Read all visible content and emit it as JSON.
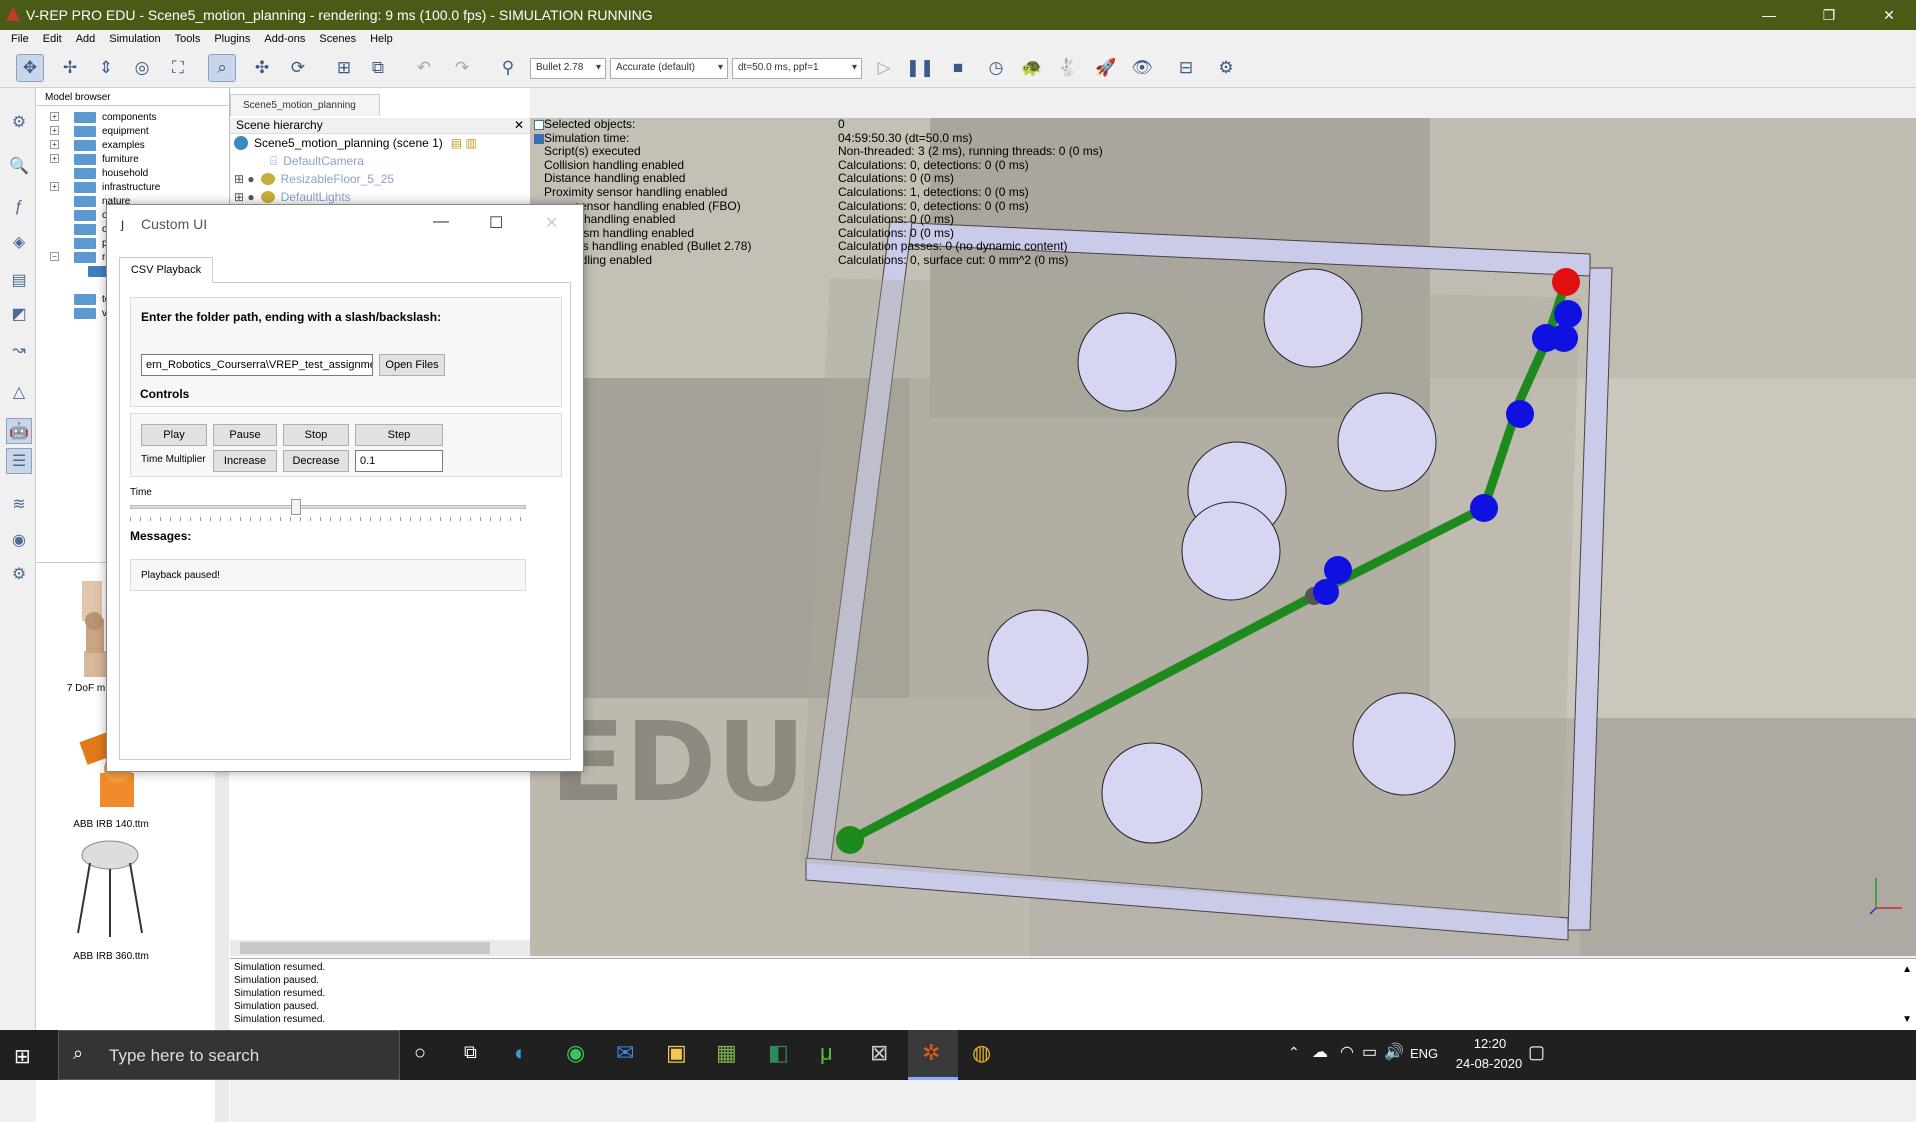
{
  "title": "V-REP PRO EDU - Scene5_motion_planning - rendering: 9 ms (100.0 fps) - SIMULATION RUNNING",
  "menu": [
    "File",
    "Edit",
    "Add",
    "Simulation",
    "Tools",
    "Plugins",
    "Add-ons",
    "Scenes",
    "Help"
  ],
  "toolbar": {
    "engine": "Bullet 2.78",
    "accuracy": "Accurate (default)",
    "timestep": "dt=50.0 ms, ppf=1"
  },
  "model_browser": {
    "header": "Model browser",
    "items": [
      "components",
      "equipment",
      "examples",
      "furniture",
      "household",
      "infrastructure",
      "nature",
      "of",
      "ot",
      "pe",
      "ro",
      "to",
      "ve"
    ],
    "thumbs": [
      "7 DoF m",
      "ABB IRB 140.ttm",
      "ABB IRB 360.ttm"
    ]
  },
  "scene_tab": "Scene5_motion_planning",
  "hierarchy": {
    "header": "Scene hierarchy",
    "rows": [
      "Scene5_motion_planning (scene 1)",
      "DefaultCamera",
      "ResizableFloor_5_25",
      "DefaultLights"
    ]
  },
  "info": {
    "keys": [
      "Selected objects:",
      "Simulation time:",
      "Script(s) executed",
      "Collision handling enabled",
      "Distance handling enabled",
      "Proximity sensor handling enabled",
      "sensor handling enabled (FBO)",
      "p handling enabled",
      "nism handling enabled",
      "ics handling enabled (Bullet 2.78)",
      "ndling enabled"
    ],
    "values": [
      "0",
      "04:59:50.30 (dt=50.0 ms)",
      "Non-threaded: 3 (2 ms), running threads: 0 (0 ms)",
      "Calculations: 0, detections: 0 (0 ms)",
      "Calculations: 0 (0 ms)",
      "Calculations: 1, detections: 0 (0 ms)",
      "Calculations: 0, detections: 0 (0 ms)",
      "Calculations: 0 (0 ms)",
      "Calculations: 0 (0 ms)",
      "Calculation passes: 0 (no dynamic content)",
      "Calculations: 0, surface cut: 0 mm^2 (0 ms)"
    ]
  },
  "watermark": "EDU",
  "dialog": {
    "title": "Custom UI",
    "tab": "CSV Playback",
    "folder_prompt": "Enter the folder path, ending with a slash/backslash:",
    "folder_value": "ern_Robotics_Courserra\\VREP_test_assignment2_week4\\",
    "open_files": "Open Files",
    "controls_label": "Controls",
    "play": "Play",
    "pause": "Pause",
    "stop": "Stop",
    "step": "Step",
    "time_multiplier": "Time Multiplier",
    "increase": "Increase",
    "decrease": "Decrease",
    "multiplier_value": "0.1",
    "time_label": "Time",
    "time_slider_position": 0.42,
    "messages_label": "Messages:",
    "message": "Playback paused!"
  },
  "console": [
    "Simulation resumed.",
    "Simulation paused.",
    "Simulation resumed.",
    "Simulation paused.",
    "Simulation resumed."
  ],
  "taskbar": {
    "search_placeholder": "Type here to search",
    "lang": "ENG",
    "time": "12:20",
    "date": "24-08-2020"
  }
}
